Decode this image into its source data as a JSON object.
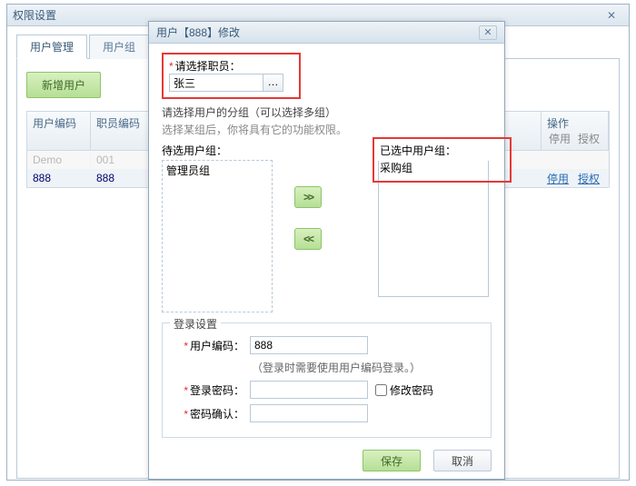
{
  "outer": {
    "title": "权限设置",
    "tabs": [
      "用户管理",
      "用户组"
    ],
    "add_user": "新增用户",
    "columns": [
      "用户编码",
      "职员编码",
      "",
      "操作"
    ],
    "op_sub": [
      "停用",
      "授权"
    ],
    "rows": [
      {
        "code": "Demo",
        "emp": "001",
        "name": "",
        "ops": [
          "",
          ""
        ],
        "disabled": true
      },
      {
        "code": "888",
        "emp": "888",
        "name": "",
        "ops": [
          "停用",
          "授权"
        ],
        "disabled": false
      }
    ]
  },
  "modal": {
    "title": "用户【888】修改",
    "pick_label": "请选择职员：",
    "pick_value": "张三",
    "hint1": "请选择用户的分组（可以选择多组）",
    "hint2": "选择某组后，你将具有它的功能权限。",
    "avail_label": "待选用户组：",
    "avail_items": [
      "管理员组"
    ],
    "selected_label": "已选中用户组：",
    "selected_items": [
      "采购组"
    ],
    "arrows": {
      "right": ">>",
      "left": "<<"
    },
    "login_legend": "登录设置",
    "code_label": "用户编码：",
    "code_value": "888",
    "code_note": "（登录时需要使用用户编码登录。）",
    "pwd_label": "登录密码：",
    "pwd_value": "",
    "change_pwd": "修改密码",
    "pwd2_label": "密码确认：",
    "pwd2_value": "",
    "save": "保存",
    "cancel": "取消"
  }
}
